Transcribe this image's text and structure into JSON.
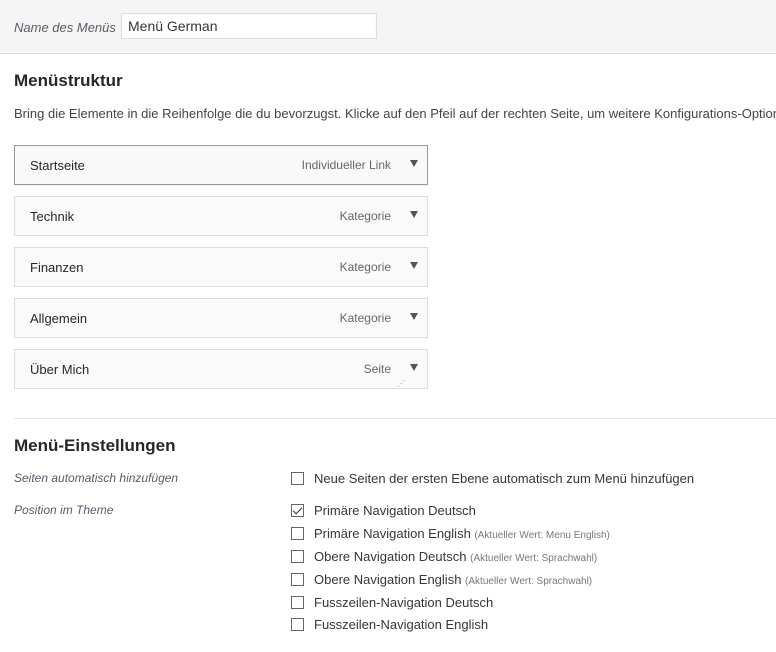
{
  "header": {
    "name_label": "Name des Menüs",
    "name_value": "Menü German"
  },
  "structure": {
    "title": "Menüstruktur",
    "description": "Bring die Elemente in die Reihenfolge die du bevorzugst. Klicke auf den Pfeil auf der rechten Seite, um weitere Konfigurations-Optionen"
  },
  "menu_items": [
    {
      "title": "Startseite",
      "type": "Individueller Link"
    },
    {
      "title": "Technik",
      "type": "Kategorie"
    },
    {
      "title": "Finanzen",
      "type": "Kategorie"
    },
    {
      "title": "Allgemein",
      "type": "Kategorie"
    },
    {
      "title": "Über Mich",
      "type": "Seite"
    }
  ],
  "settings": {
    "title": "Menü-Einstellungen",
    "auto_add_label": "Seiten automatisch hinzufügen",
    "auto_add_option": "Neue Seiten der ersten Ebene automatisch zum Menü hinzufügen",
    "auto_add_checked": false,
    "position_label": "Position im Theme",
    "locations": [
      {
        "label": "Primäre Navigation Deutsch",
        "hint": "",
        "checked": true
      },
      {
        "label": "Primäre Navigation English",
        "hint": "(Aktueller Wert: Menu English)",
        "checked": false
      },
      {
        "label": "Obere Navigation Deutsch",
        "hint": "(Aktueller Wert: Sprachwahl)",
        "checked": false
      },
      {
        "label": "Obere Navigation English",
        "hint": "(Aktueller Wert: Sprachwahl)",
        "checked": false
      },
      {
        "label": "Fusszeilen-Navigation Deutsch",
        "hint": "",
        "checked": false
      },
      {
        "label": "Fusszeilen-Navigation English",
        "hint": "",
        "checked": false
      }
    ]
  }
}
